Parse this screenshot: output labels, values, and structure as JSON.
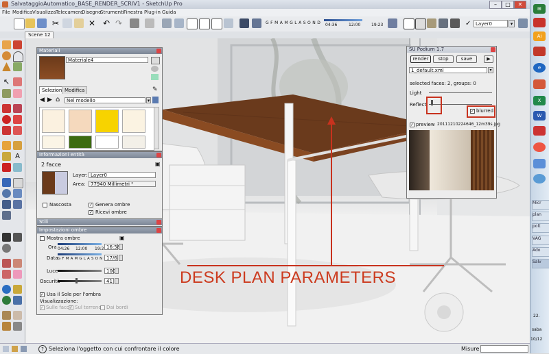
{
  "app": {
    "title": "SalvataggioAutomatico_BASE_RENDER_SCRIV1 - SketchUp Pro"
  },
  "menu": [
    "File",
    "Modifica",
    "Visualizza",
    "Telecamera",
    "Disegno",
    "Strumenti",
    "Finestra",
    "Plug-in",
    "Guida"
  ],
  "toolbar": {
    "shadow_months": "G F M A M G L A S O N D",
    "time_start": "04:36",
    "time_mid": "12:00",
    "time_end": "19:23",
    "layer_value": "Layer0"
  },
  "scene_tab": "Scene 12",
  "materials_panel": {
    "title": "Materiali",
    "material_name": "Materiale4",
    "tabs": [
      "Selezione",
      "Modifica"
    ],
    "library": "Nel modello",
    "swatch_colors": [
      "#fbf1e0",
      "#f5d9bd",
      "#f7d300",
      "#fbf3e2",
      "#fbf5e6",
      "#3d6b10",
      "#ffffff",
      "#f3f0e8"
    ]
  },
  "entity_panel": {
    "title": "Informazioni entità",
    "count": "2 facce",
    "layer_label": "Layer:",
    "layer_value": "Layer0",
    "area_label": "Area:",
    "area_value": "77940 Millimetri ²",
    "hidden_label": "Nascosta",
    "cast_shadows": "Genera ombre",
    "receive_shadows": "Ricevi ombre"
  },
  "styles_panel": {
    "title": "Stili"
  },
  "shadow_panel": {
    "title": "Impostazioni ombre",
    "show_shadows": "Mostra ombre",
    "time_label": "Ora",
    "time_start": "04:26",
    "time_mid": "12:00",
    "time_end": "19:23",
    "time_value": "16:58",
    "date_label": "Data",
    "months": "G F M A M G L A S O N D",
    "date_value": "17/6",
    "light_label": "Luce",
    "light_value": "100",
    "dark_label": "Oscurità",
    "dark_value": "41",
    "sun_label": "Usa il Sole per l'ombra",
    "display_label": "Visualizzazione:",
    "on_faces": "Sulle facce",
    "on_ground": "Sul terreno",
    "from_edges": "Dai bordi"
  },
  "podium": {
    "title": "SU Podium 1.7",
    "render": "render",
    "stop": "stop",
    "save": "save",
    "play": "▶",
    "preset": "1_default.xml",
    "selected": "selected faces: 2, groups: 0",
    "light_label": "Light",
    "reflect_label": "Reflect",
    "blurred_label": "blurred",
    "preview_label": "preview",
    "preview_file": "20111210224646_12m39s.jpg"
  },
  "annotation": "DESK PLAN PARAMETERS",
  "status": {
    "text": "Seleziona l'oggetto con cui confrontare il colore",
    "measures": "Misure"
  },
  "taskbar": {
    "items": [
      "Micr",
      "plan",
      "polt",
      "VAG",
      "Ado",
      "Salv"
    ],
    "time_date": "22.",
    "day": "saba",
    "date": "10/12"
  }
}
